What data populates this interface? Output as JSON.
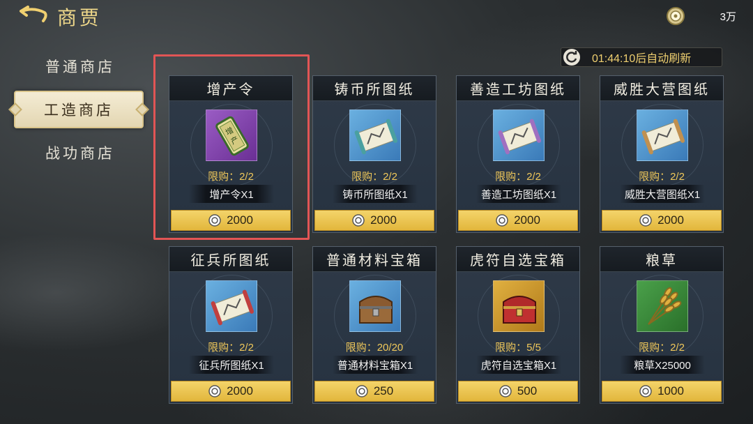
{
  "header": {
    "title": "商贾",
    "currency_value": "3万"
  },
  "sidebar": {
    "items": [
      {
        "label": "普通商店",
        "active": false
      },
      {
        "label": "工造商店",
        "active": true
      },
      {
        "label": "战功商店",
        "active": false
      }
    ]
  },
  "refresh": {
    "text": "01:44:10后自动刷新"
  },
  "items": [
    {
      "title": "增产令",
      "limit": "限购：2/2",
      "name": "增产令X1",
      "price": "2000",
      "icon": "token-icon"
    },
    {
      "title": "铸币所图纸",
      "limit": "限购：2/2",
      "name": "铸币所图纸X1",
      "price": "2000",
      "icon": "blueprint-scroll-icon"
    },
    {
      "title": "善造工坊图纸",
      "limit": "限购：2/2",
      "name": "善造工坊图纸X1",
      "price": "2000",
      "icon": "blueprint-scroll-icon"
    },
    {
      "title": "威胜大营图纸",
      "limit": "限购：2/2",
      "name": "威胜大营图纸X1",
      "price": "2000",
      "icon": "blueprint-scroll-icon"
    },
    {
      "title": "征兵所图纸",
      "limit": "限购：2/2",
      "name": "征兵所图纸X1",
      "price": "2000",
      "icon": "blueprint-scroll-icon"
    },
    {
      "title": "普通材料宝箱",
      "limit": "限购：20/20",
      "name": "普通材料宝箱X1",
      "price": "250",
      "icon": "wooden-chest-icon"
    },
    {
      "title": "虎符自选宝箱",
      "limit": "限购：5/5",
      "name": "虎符自选宝箱X1",
      "price": "500",
      "icon": "red-chest-icon"
    },
    {
      "title": "粮草",
      "limit": "限购：2/2",
      "name": "粮草X25000",
      "price": "1000",
      "icon": "wheat-icon"
    }
  ],
  "colors": {
    "accent_gold": "#f0d070",
    "price_button": "#f4d46a",
    "highlight": "#e25555",
    "icon_bg_purple": "#8a4fb0",
    "icon_bg_blue": "#4a8cc8",
    "icon_bg_gold": "#c89a2a",
    "icon_bg_green": "#3a8a3a"
  }
}
